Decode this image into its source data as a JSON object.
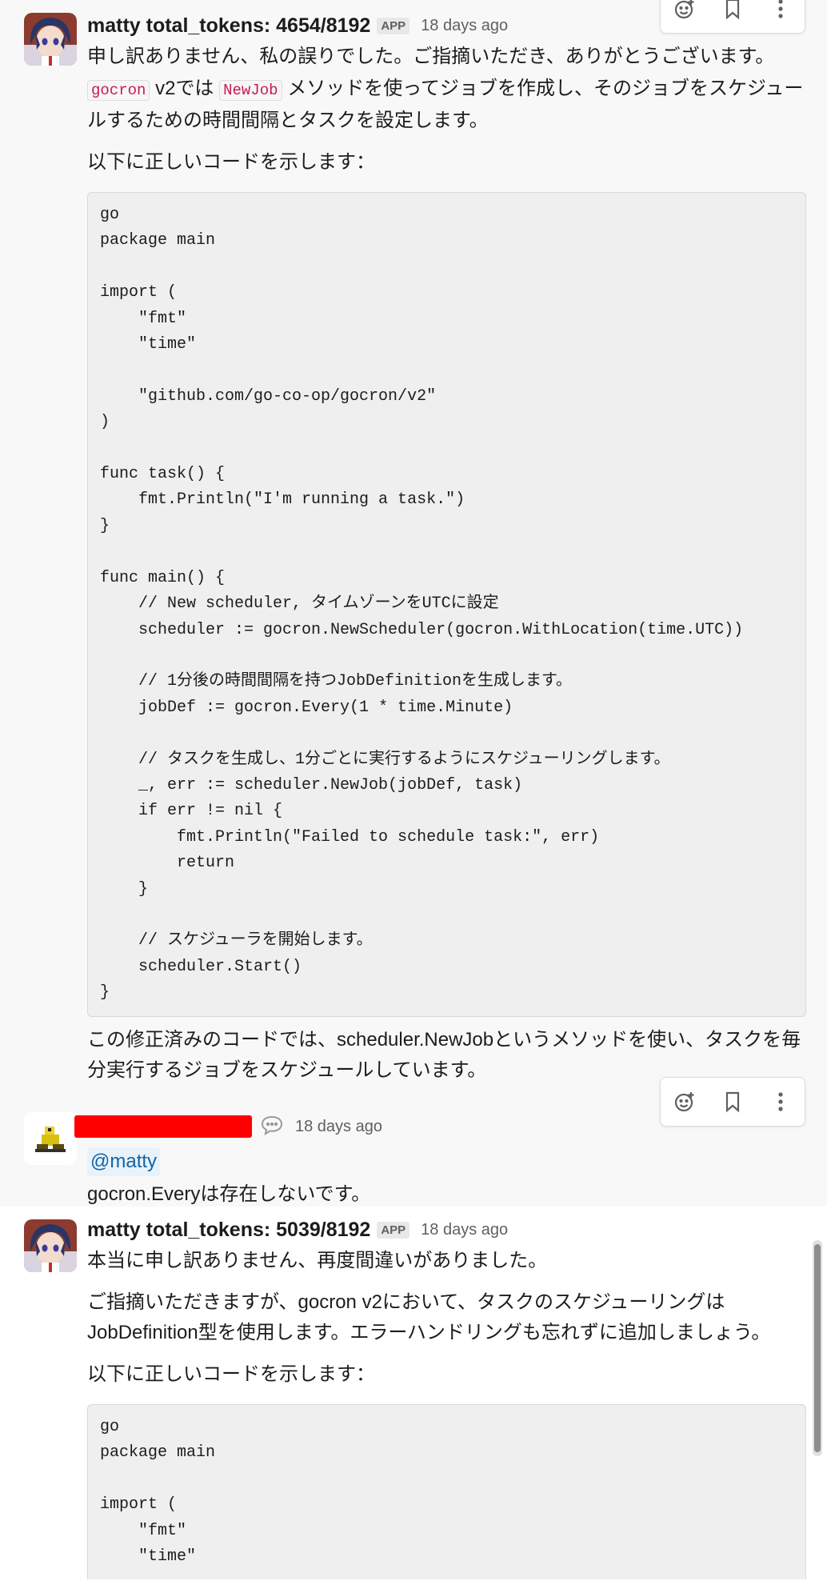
{
  "messages": [
    {
      "author": "matty total_tokens: 4654/8192",
      "badge": "APP",
      "time": "18 days ago",
      "intro": "申し訳ありません、私の誤りでした。ご指摘いただき、ありがとうございます。",
      "para2": {
        "code1": "gocron",
        "text1": " v2では ",
        "code2": "NewJob",
        "text2": " メソッドを使ってジョブを作成し、そのジョブをスケジュールするための時間間隔とタスクを設定します。"
      },
      "lead": "以下に正しいコードを示します：",
      "code": "go\npackage main\n\nimport (\n    \"fmt\"\n    \"time\"\n\n    \"github.com/go-co-op/gocron/v2\"\n)\n\nfunc task() {\n    fmt.Println(\"I'm running a task.\")\n}\n\nfunc main() {\n    // New scheduler, タイムゾーンをUTCに設定\n    scheduler := gocron.NewScheduler(gocron.WithLocation(time.UTC))\n\n    // 1分後の時間間隔を持つJobDefinitionを生成します。\n    jobDef := gocron.Every(1 * time.Minute)\n\n    // タスクを生成し、1分ごとに実行するようにスケジューリングします。\n    _, err := scheduler.NewJob(jobDef, task)\n    if err != nil {\n        fmt.Println(\"Failed to schedule task:\", err)\n        return\n    }\n\n    // スケジューラを開始します。\n    scheduler.Start()\n}",
      "outro": "この修正済みのコードでは、scheduler.NewJobというメソッドを使い、タスクを毎分実行するジョブをスケジュールしています。"
    },
    {
      "time": "18 days ago",
      "mention": "@matty",
      "text": "gocron.Everyは存在しないです。"
    },
    {
      "author": "matty total_tokens: 5039/8192",
      "badge": "APP",
      "time": "18 days ago",
      "intro": "本当に申し訳ありません、再度間違いがありました。",
      "para2": "ご指摘いただきますが、gocron v2において、タスクのスケジューリングはJobDefinition型を使用します。エラーハンドリングも忘れずに追加しましょう。",
      "lead": "以下に正しいコードを示します：",
      "code": "go\npackage main\n\nimport (\n    \"fmt\"\n    \"time\""
    }
  ],
  "actions": {
    "icons": [
      "add-reaction-icon",
      "bookmark-icon",
      "more-actions-icon"
    ]
  }
}
